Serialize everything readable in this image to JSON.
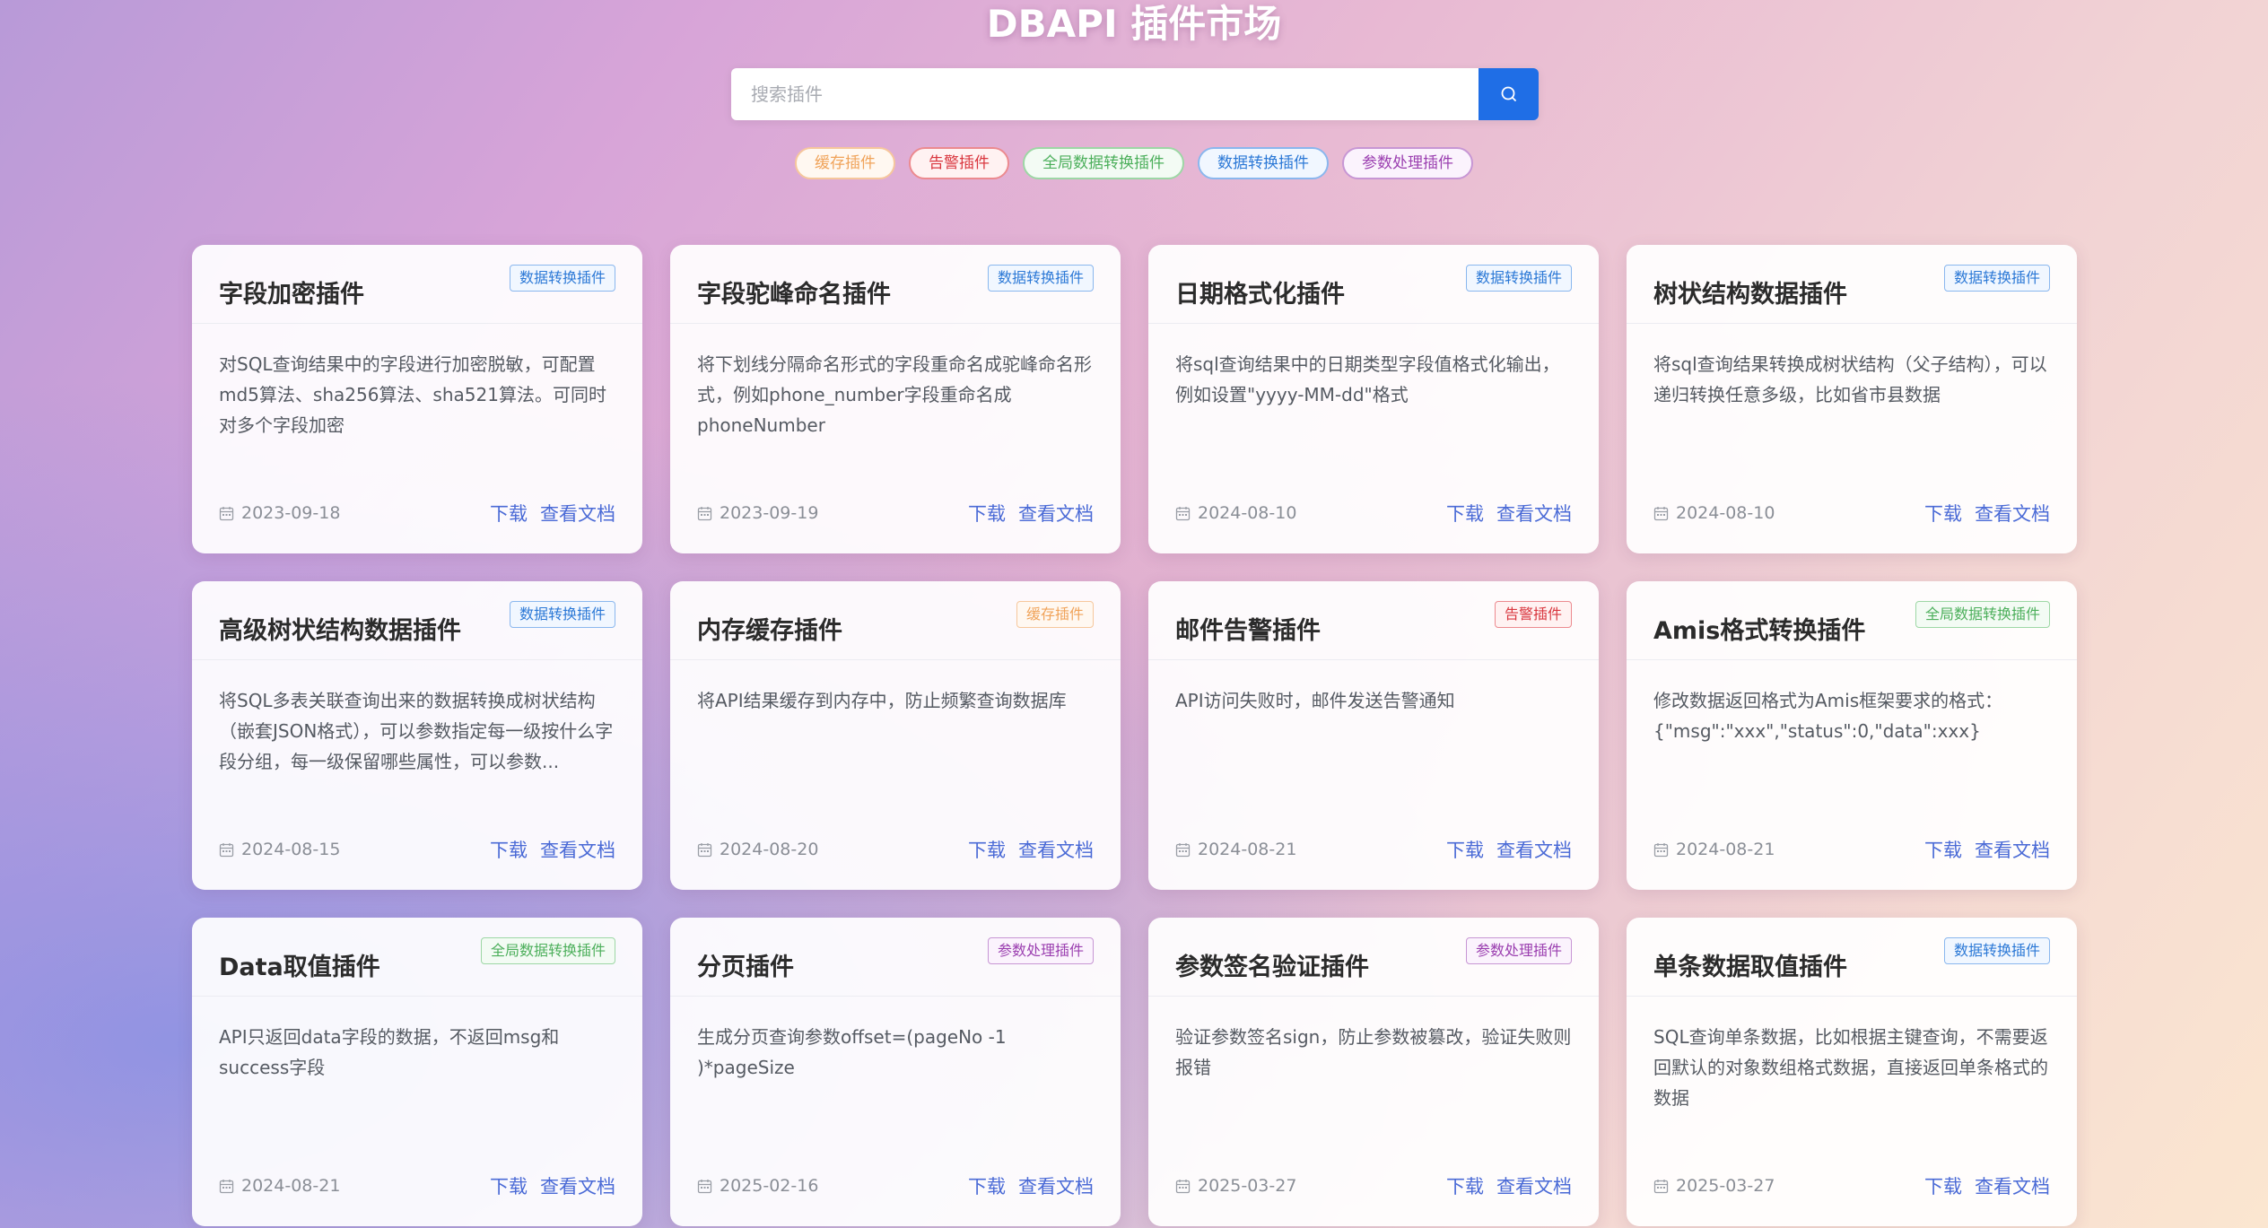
{
  "header": {
    "title": "DBAPI 插件市场"
  },
  "search": {
    "placeholder": "搜索插件",
    "button_icon": "search-icon"
  },
  "filter_tags": [
    {
      "label": "缓存插件",
      "color": "#f0a35a"
    },
    {
      "label": "告警插件",
      "color": "#d9363e"
    },
    {
      "label": "全局数据转换插件",
      "color": "#4caf5b"
    },
    {
      "label": "数据转换插件",
      "color": "#2b78d6"
    },
    {
      "label": "参数处理插件",
      "color": "#9b3fb0"
    }
  ],
  "actions": {
    "download": "下载",
    "docs": "查看文档"
  },
  "plugins": [
    {
      "name": "字段加密插件",
      "category": "数据转换插件",
      "desc": "对SQL查询结果中的字段进行加密脱敏，可配置md5算法、sha256算法、sha521算法。可同时对多个字段加密",
      "date": "2023-09-18"
    },
    {
      "name": "字段驼峰命名插件",
      "category": "数据转换插件",
      "desc": "将下划线分隔命名形式的字段重命名成驼峰命名形式，例如phone_number字段重命名成phoneNumber",
      "date": "2023-09-19"
    },
    {
      "name": "日期格式化插件",
      "category": "数据转换插件",
      "desc": "将sql查询结果中的日期类型字段值格式化输出，例如设置\"yyyy-MM-dd\"格式",
      "date": "2024-08-10"
    },
    {
      "name": "树状结构数据插件",
      "category": "数据转换插件",
      "desc": "将sql查询结果转换成树状结构（父子结构），可以递归转换任意多级，比如省市县数据",
      "date": "2024-08-10"
    },
    {
      "name": "高级树状结构数据插件",
      "category": "数据转换插件",
      "desc": "将SQL多表关联查询出来的数据转换成树状结构（嵌套JSON格式），可以参数指定每一级按什么字段分组，每一级保留哪些属性，可以参数...",
      "date": "2024-08-15"
    },
    {
      "name": "内存缓存插件",
      "category": "缓存插件",
      "desc": "将API结果缓存到内存中，防止频繁查询数据库",
      "date": "2024-08-20"
    },
    {
      "name": "邮件告警插件",
      "category": "告警插件",
      "desc": "API访问失败时，邮件发送告警通知",
      "date": "2024-08-21"
    },
    {
      "name": "Amis格式转换插件",
      "category": "全局数据转换插件",
      "desc": "修改数据返回格式为Amis框架要求的格式：{\"msg\":\"xxx\",\"status\":0,\"data\":xxx}",
      "date": "2024-08-21"
    },
    {
      "name": "Data取值插件",
      "category": "全局数据转换插件",
      "desc": "API只返回data字段的数据，不返回msg和success字段",
      "date": "2024-08-21"
    },
    {
      "name": "分页插件",
      "category": "参数处理插件",
      "desc": "生成分页查询参数offset=(pageNo -1 )*pageSize",
      "date": "2025-02-16"
    },
    {
      "name": "参数签名验证插件",
      "category": "参数处理插件",
      "desc": "验证参数签名sign，防止参数被篡改，验证失败则报错",
      "date": "2025-03-27"
    },
    {
      "name": "单条数据取值插件",
      "category": "数据转换插件",
      "desc": "SQL查询单条数据，比如根据主键查询，不需要返回默认的对象数组格式数据，直接返回单条格式的数据",
      "date": "2025-03-27"
    }
  ]
}
